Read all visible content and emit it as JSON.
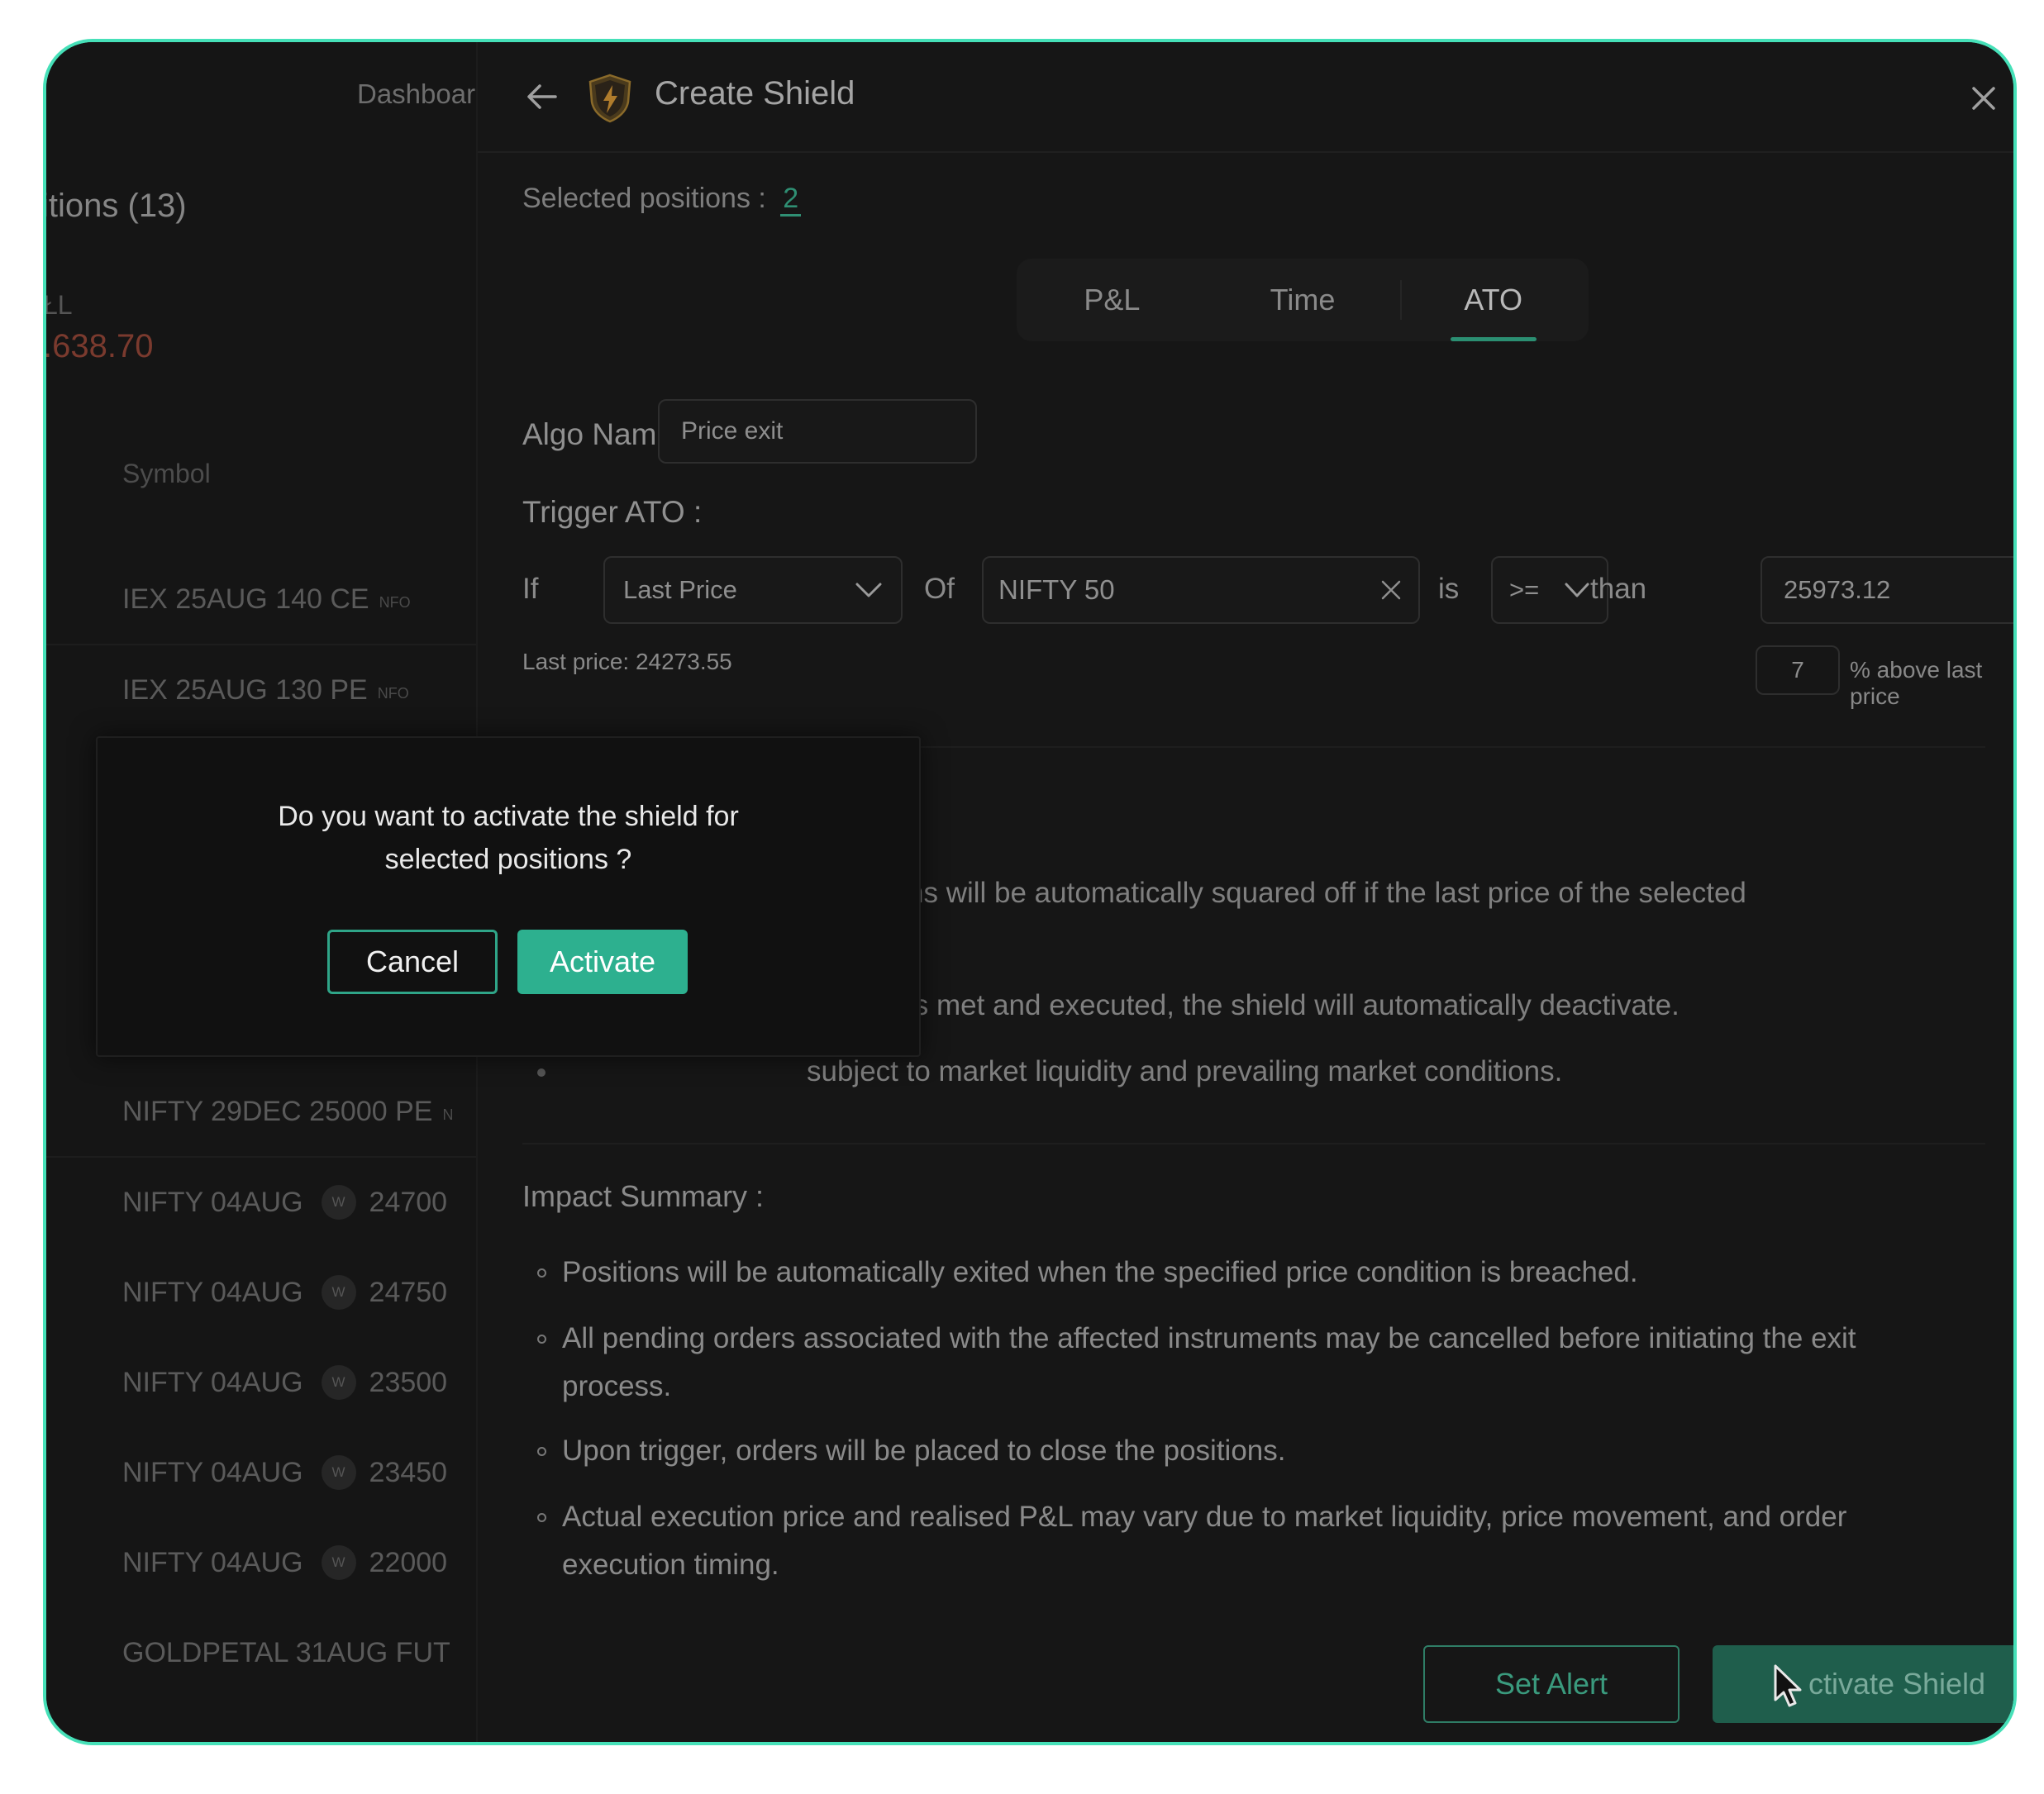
{
  "background": {
    "dashboard_label": "Dashboar",
    "positions_label": "itions (13)",
    "pnl_label": "ŁL",
    "pnl_value": ".638.70",
    "symbol_header": "Symbol",
    "rows": [
      {
        "symbol": "IEX 25AUG 140 CE",
        "tag": "NFO"
      },
      {
        "symbol": "IEX 25AUG 130 PE",
        "tag": "NFO"
      },
      {
        "symbol": "NIFTY 29DEC 25000 PE",
        "tag": "N"
      },
      {
        "symbol": "NIFTY 04AUG",
        "weekly": "W",
        "strike": "24700"
      },
      {
        "symbol": "NIFTY 04AUG",
        "weekly": "W",
        "strike": "24750"
      },
      {
        "symbol": "NIFTY 04AUG",
        "weekly": "W",
        "strike": "23500"
      },
      {
        "symbol": "NIFTY 04AUG",
        "weekly": "W",
        "strike": "23450"
      },
      {
        "symbol": "NIFTY 04AUG",
        "weekly": "W",
        "strike": "22000"
      },
      {
        "symbol": "GOLDPETAL 31AUG FUT"
      }
    ]
  },
  "panel": {
    "title": "Create Shield",
    "selected_label": "Selected positions :",
    "selected_count": "2",
    "tabs": [
      {
        "label": "P&L",
        "active": false
      },
      {
        "label": "Time",
        "active": false
      },
      {
        "label": "ATO",
        "active": true
      }
    ],
    "algo_name_label": "Algo Name :",
    "algo_name_value": "Price exit",
    "trigger_label": "Trigger ATO :",
    "if_label": "If",
    "price_type": "Last Price",
    "of_label": "Of",
    "instrument": "NIFTY 50",
    "is_label": "is",
    "operator": ">=",
    "than_label": "than",
    "target_price": "25973.12",
    "last_price_label": "Last price:",
    "last_price_value": "24273.55",
    "percent_value": "7",
    "percent_label": "% above last price",
    "conditions": [
      "ns will be automatically squared off if the last price of the selected",
      "is met and executed, the shield will automatically deactivate.",
      "subject to market liquidity and prevailing market conditions."
    ],
    "impact_title": "Impact Summary :",
    "impact_items": [
      "Positions will be automatically exited when the specified price condition is breached.",
      "All pending orders associated with the affected instruments may be cancelled before initiating the exit process.",
      "Upon trigger, orders will be placed to close the positions.",
      "Actual execution price and realised P&L may vary due to market liquidity, price movement, and order execution timing."
    ],
    "set_alert_label": "Set Alert",
    "activate_shield_label": "ctivate Shield"
  },
  "dialog": {
    "question_line1": "Do you want to activate the shield for",
    "question_line2": "selected positions ?",
    "cancel_label": "Cancel",
    "activate_label": "Activate"
  },
  "colors": {
    "accent": "#2db08f",
    "frame_border": "#46e0b8",
    "background": "#161616",
    "loss": "#7a3a2e"
  }
}
